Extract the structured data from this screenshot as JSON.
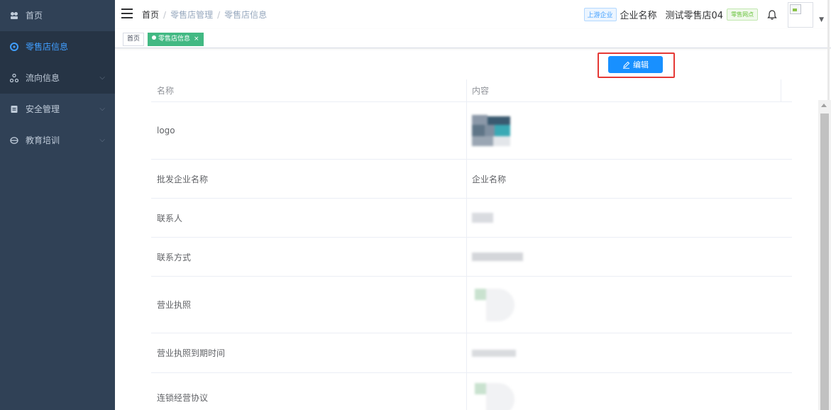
{
  "sidebar": {
    "items": [
      {
        "label": "首页",
        "icon": "dashboard-icon",
        "expandable": false,
        "active": false
      },
      {
        "label": "零售店信息",
        "icon": "store-info-icon",
        "expandable": false,
        "active": true
      },
      {
        "label": "流向信息",
        "icon": "flow-icon",
        "expandable": true,
        "active": false
      },
      {
        "label": "安全管理",
        "icon": "document-icon",
        "expandable": true,
        "active": false
      },
      {
        "label": "教育培训",
        "icon": "education-icon",
        "expandable": true,
        "active": false
      }
    ]
  },
  "header": {
    "breadcrumb": [
      "首页",
      "零售店管理",
      "零售店信息"
    ],
    "upstream_tag": "上游企业",
    "company_name": "企业名称",
    "store_name": "测试零售店04",
    "store_tag": "零售网点"
  },
  "tags_view": [
    {
      "label": "首页",
      "active": false
    },
    {
      "label": "零售店信息",
      "active": true,
      "close": "×"
    }
  ],
  "toolbar": {
    "edit_label": "编辑"
  },
  "table": {
    "columns": [
      "名称",
      "内容"
    ],
    "rows": [
      {
        "name": "logo",
        "content": ""
      },
      {
        "name": "批发企业名称",
        "content": "企业名称"
      },
      {
        "name": "联系人",
        "content": ""
      },
      {
        "name": "联系方式",
        "content": ""
      },
      {
        "name": "营业执照",
        "content": ""
      },
      {
        "name": "营业执照到期时间",
        "content": ""
      },
      {
        "name": "连锁经营协议",
        "content": ""
      }
    ]
  },
  "colors": {
    "sidebar_bg": "#304156",
    "sidebar_active_text": "#409eff",
    "edit_button": "#1890ff",
    "highlight_border": "#e53935",
    "active_tag": "#42b983"
  }
}
